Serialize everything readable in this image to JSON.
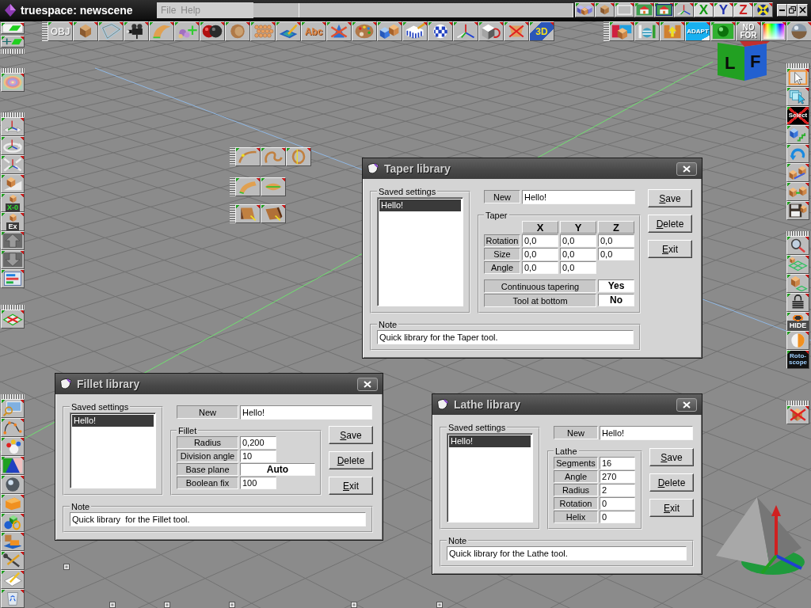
{
  "title_bar": {
    "title": "truespace: newscene",
    "menu": [
      {
        "label": "File"
      },
      {
        "label": "Help"
      }
    ],
    "tools": [
      {
        "kind": "cubes"
      },
      {
        "kind": "cube"
      },
      {
        "kind": "rectangle"
      },
      {
        "kind": "house"
      },
      {
        "kind": "house-frame"
      },
      {
        "kind": "axes"
      },
      {
        "kind": "axis",
        "label": "X",
        "color": "#119911"
      },
      {
        "kind": "axis",
        "label": "Y",
        "color": "#2233b0"
      },
      {
        "kind": "axis",
        "label": "Z",
        "color": "#cc2222"
      },
      {
        "kind": "cross-disc"
      }
    ]
  },
  "main_toolbar": {
    "tools": [
      {
        "kind": "obj",
        "label": "OBJ"
      },
      {
        "kind": "cube"
      },
      {
        "kind": "frame"
      },
      {
        "kind": "camera"
      },
      {
        "kind": "curved-shape"
      },
      {
        "kind": "blobs-plus"
      },
      {
        "kind": "spheres"
      },
      {
        "kind": "ring"
      },
      {
        "kind": "dots"
      },
      {
        "kind": "plane-pencil"
      },
      {
        "kind": "text3d",
        "label": "Abc"
      },
      {
        "kind": "cone-cross"
      },
      {
        "kind": "palette"
      },
      {
        "kind": "blocks"
      },
      {
        "kind": "striped-cube"
      },
      {
        "kind": "checkered-sphere"
      },
      {
        "kind": "axes"
      },
      {
        "kind": "cube-arrow"
      },
      {
        "kind": "shape-cross"
      },
      {
        "kind": "plug",
        "label": "3D"
      }
    ]
  },
  "secondary_toolbar": {
    "tools": [
      {
        "kind": "color-blocks"
      },
      {
        "kind": "columns-ball"
      },
      {
        "kind": "arrow-up"
      },
      {
        "kind": "adapt",
        "label": "ADAPT"
      },
      {
        "kind": "glossy-sphere"
      },
      {
        "kind": "noform",
        "label": "NO FOR"
      },
      {
        "kind": "spectrum"
      },
      {
        "kind": "mirror-sphere"
      }
    ]
  },
  "view_cube": {
    "left": "L",
    "front": "F"
  },
  "palettes": [
    {
      "tools": [
        {
          "kind": "parallelogram"
        },
        {
          "kind": "plus-parallelogram"
        }
      ]
    },
    {
      "tools": [
        {
          "kind": "rainbow"
        }
      ]
    },
    {
      "tools": [
        {
          "kind": "move-axes"
        },
        {
          "kind": "rotate-axes"
        },
        {
          "kind": "scale-axes"
        },
        {
          "kind": "cube-ramp"
        },
        {
          "kind": "x-zero",
          "label": "X-0"
        },
        {
          "kind": "ex",
          "label": "Ex"
        },
        {
          "kind": "up-arrow"
        },
        {
          "kind": "down-arrow"
        },
        {
          "kind": "list"
        }
      ]
    },
    {
      "tools": [
        {
          "kind": "plane-cross"
        }
      ]
    },
    {
      "tools": [
        {
          "kind": "picture-magnifier"
        },
        {
          "kind": "curve-points"
        },
        {
          "kind": "figure-balls"
        },
        {
          "kind": "cone"
        },
        {
          "kind": "chrome-sphere"
        },
        {
          "kind": "armchair"
        },
        {
          "kind": "shapes"
        },
        {
          "kind": "room"
        },
        {
          "kind": "tools"
        },
        {
          "kind": "paper-pencil"
        },
        {
          "kind": "recycle-bin"
        }
      ]
    },
    {
      "tools": [
        {
          "kind": "curve"
        },
        {
          "kind": "loop-curve"
        },
        {
          "kind": "lathe-curve"
        }
      ]
    },
    {
      "tools": [
        {
          "kind": "sweep"
        },
        {
          "kind": "twist"
        }
      ]
    },
    {
      "tools": [
        {
          "kind": "bevel"
        },
        {
          "kind": "bevel-edge"
        }
      ]
    },
    {
      "tools": [
        {
          "kind": "arrow-cursor"
        },
        {
          "kind": "windows-pointer"
        },
        {
          "kind": "select",
          "label": "Select"
        },
        {
          "kind": "cube-steps"
        },
        {
          "kind": "circular-arrow"
        },
        {
          "kind": "cubes-arrow"
        },
        {
          "kind": "cubes-link"
        },
        {
          "kind": "floppy-disk"
        }
      ]
    },
    {
      "tools": [
        {
          "kind": "magnifier"
        },
        {
          "kind": "grid-cube"
        },
        {
          "kind": "cube-grid"
        },
        {
          "kind": "padlock"
        },
        {
          "kind": "hide",
          "label": "HIDE"
        },
        {
          "kind": "half-sphere"
        },
        {
          "kind": "rotoscope",
          "label": "Roto-scope"
        }
      ]
    },
    {
      "tools": [
        {
          "kind": "cube-cross"
        }
      ]
    }
  ],
  "dialogs": [
    {
      "kind": "taper",
      "title": "Taper library",
      "saved_label": "Saved settings",
      "saved_items": [
        {
          "label": "Hello!",
          "selected": true
        }
      ],
      "new_label": "New",
      "new_value": "Hello!",
      "group_label": "Taper",
      "columns": [
        "X",
        "Y",
        "Z"
      ],
      "rows": [
        {
          "label": "Rotation",
          "values": [
            "0,0",
            "0,0",
            "0,0"
          ]
        },
        {
          "label": "Size",
          "values": [
            "0,0",
            "0,0",
            "0,0"
          ]
        },
        {
          "label": "Angle",
          "values": [
            "0,0",
            "0,0"
          ]
        }
      ],
      "toggles": [
        {
          "label": "Continuous tapering",
          "value": "Yes"
        },
        {
          "label": "Tool at bottom",
          "value": "No"
        }
      ],
      "buttons": [
        "Save",
        "Delete",
        "Exit"
      ],
      "note_label": "Note",
      "note": "Quick library for the Taper tool."
    },
    {
      "kind": "fillet",
      "title": "Fillet library",
      "saved_label": "Saved settings",
      "saved_items": [
        {
          "label": "Hello!",
          "selected": true
        }
      ],
      "new_label": "New",
      "new_value": "Hello!",
      "group_label": "Fillet",
      "rows": [
        {
          "label": "Radius",
          "value": "0,200",
          "kind": "number"
        },
        {
          "label": "Division angle",
          "value": "10",
          "kind": "number"
        },
        {
          "label": "Base plane",
          "value": "Auto",
          "kind": "choice"
        },
        {
          "label": "Boolean fix",
          "value": "100",
          "kind": "number"
        }
      ],
      "buttons": [
        "Save",
        "Delete",
        "Exit"
      ],
      "note_label": "Note",
      "note": "Quick library  for the Fillet tool."
    },
    {
      "kind": "lathe",
      "title": "Lathe library",
      "saved_label": "Saved settings",
      "saved_items": [
        {
          "label": "Hello!",
          "selected": true
        }
      ],
      "new_label": "New",
      "new_value": "Hello!",
      "group_label": "Lathe",
      "rows": [
        {
          "label": "Segments",
          "value": "16",
          "kind": "number"
        },
        {
          "label": "Angle",
          "value": "270",
          "kind": "number"
        },
        {
          "label": "Radius",
          "value": "2",
          "kind": "number"
        },
        {
          "label": "Rotation",
          "value": "0",
          "kind": "number"
        },
        {
          "label": "Helix",
          "value": "0",
          "kind": "number"
        }
      ],
      "buttons": [
        "Save",
        "Delete",
        "Exit"
      ],
      "note_label": "Note",
      "note": "Quick library for the Lathe tool."
    }
  ]
}
